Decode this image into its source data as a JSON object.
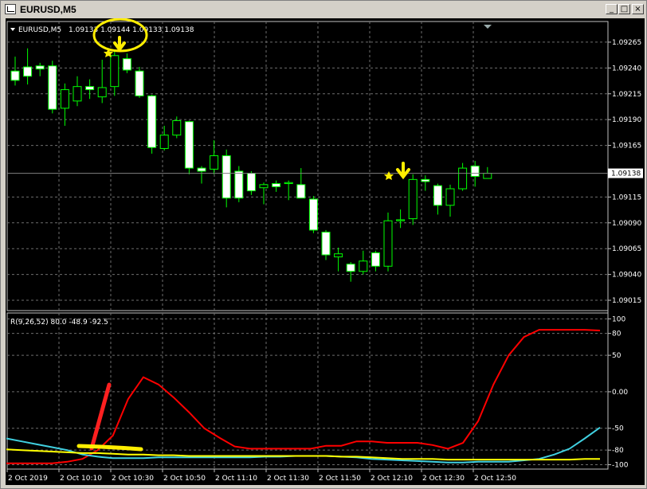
{
  "window": {
    "title": "EURUSD,M5",
    "minimize_glyph": "_",
    "restore_glyph": "□",
    "close_glyph": "×"
  },
  "header": {
    "symbol_label": "EURUSD,M5",
    "ohlc_text": "1.09133 1.09144 1.09133 1.09138",
    "current_price": "1.09138"
  },
  "indicator": {
    "label": "R(9,26,52) 80.0 -48.9 -92.5"
  },
  "colors": {
    "background": "#000000",
    "grid": "#6e6e6e",
    "axis_text": "#ffffff",
    "bull_candle": "#000000",
    "bear_candle": "#ffffff",
    "candle_wick": "#00ff00",
    "line_red": "#ff0000",
    "line_cyan": "#40d0e0",
    "line_yellow": "#ffff00",
    "annotation_yellow": "#ffee00",
    "annotation_red": "#ff2020"
  },
  "chart_data": [
    {
      "type": "candlestick",
      "title": "EURUSD,M5",
      "y_ticks": [
        "1.09265",
        "1.09240",
        "1.09215",
        "1.09190",
        "1.09165",
        "1.09115",
        "1.09090",
        "1.09065",
        "1.09040",
        "1.09015"
      ],
      "ylim": [
        1.09005,
        1.09285
      ],
      "x_ticks": [
        "2 Oct 2019",
        "2 Oct 10:10",
        "2 Oct 10:30",
        "2 Oct 10:50",
        "2 Oct 11:10",
        "2 Oct 11:30",
        "2 Oct 11:50",
        "2 Oct 12:10",
        "2 Oct 12:30",
        "2 Oct 12:50"
      ],
      "current_price": 1.09138,
      "candles": [
        {
          "o": 1.09237,
          "h": 1.09251,
          "l": 1.09223,
          "c": 1.09228
        },
        {
          "o": 1.09241,
          "h": 1.09259,
          "l": 1.09224,
          "c": 1.09232
        },
        {
          "o": 1.09242,
          "h": 1.09245,
          "l": 1.09232,
          "c": 1.09239
        },
        {
          "o": 1.09242,
          "h": 1.09247,
          "l": 1.09196,
          "c": 1.092
        },
        {
          "o": 1.09201,
          "h": 1.09225,
          "l": 1.09184,
          "c": 1.09219
        },
        {
          "o": 1.09208,
          "h": 1.09232,
          "l": 1.09203,
          "c": 1.09222
        },
        {
          "o": 1.09222,
          "h": 1.09229,
          "l": 1.0921,
          "c": 1.09219
        },
        {
          "o": 1.09212,
          "h": 1.09248,
          "l": 1.09206,
          "c": 1.09221
        },
        {
          "o": 1.09222,
          "h": 1.09256,
          "l": 1.09213,
          "c": 1.09252
        },
        {
          "o": 1.09249,
          "h": 1.09254,
          "l": 1.09235,
          "c": 1.09238
        },
        {
          "o": 1.09237,
          "h": 1.09241,
          "l": 1.09211,
          "c": 1.09213
        },
        {
          "o": 1.09213,
          "h": 1.09214,
          "l": 1.09157,
          "c": 1.09163
        },
        {
          "o": 1.09162,
          "h": 1.09184,
          "l": 1.0916,
          "c": 1.09175
        },
        {
          "o": 1.09175,
          "h": 1.09193,
          "l": 1.09172,
          "c": 1.09189
        },
        {
          "o": 1.09188,
          "h": 1.09189,
          "l": 1.09137,
          "c": 1.09143
        },
        {
          "o": 1.09143,
          "h": 1.09145,
          "l": 1.09128,
          "c": 1.0914
        },
        {
          "o": 1.09142,
          "h": 1.0917,
          "l": 1.09137,
          "c": 1.09155
        },
        {
          "o": 1.09155,
          "h": 1.09161,
          "l": 1.09105,
          "c": 1.09114
        },
        {
          "o": 1.0914,
          "h": 1.09145,
          "l": 1.0911,
          "c": 1.09114
        },
        {
          "o": 1.09138,
          "h": 1.0914,
          "l": 1.09117,
          "c": 1.09121
        },
        {
          "o": 1.09124,
          "h": 1.09129,
          "l": 1.09108,
          "c": 1.09127
        },
        {
          "o": 1.09128,
          "h": 1.09131,
          "l": 1.0912,
          "c": 1.09125
        },
        {
          "o": 1.09128,
          "h": 1.09131,
          "l": 1.09112,
          "c": 1.09129
        },
        {
          "o": 1.09127,
          "h": 1.09143,
          "l": 1.0912,
          "c": 1.09114
        },
        {
          "o": 1.09113,
          "h": 1.09116,
          "l": 1.0908,
          "c": 1.09083
        },
        {
          "o": 1.09081,
          "h": 1.09083,
          "l": 1.09054,
          "c": 1.09059
        },
        {
          "o": 1.09057,
          "h": 1.09066,
          "l": 1.09043,
          "c": 1.0906
        },
        {
          "o": 1.0905,
          "h": 1.09052,
          "l": 1.09033,
          "c": 1.09043
        },
        {
          "o": 1.09043,
          "h": 1.09063,
          "l": 1.0904,
          "c": 1.09053
        },
        {
          "o": 1.09061,
          "h": 1.09063,
          "l": 1.09043,
          "c": 1.09048
        },
        {
          "o": 1.09048,
          "h": 1.091,
          "l": 1.09043,
          "c": 1.09092
        },
        {
          "o": 1.09092,
          "h": 1.09103,
          "l": 1.09085,
          "c": 1.09093
        },
        {
          "o": 1.09094,
          "h": 1.09137,
          "l": 1.09088,
          "c": 1.09132
        },
        {
          "o": 1.09132,
          "h": 1.09136,
          "l": 1.09121,
          "c": 1.0913
        },
        {
          "o": 1.09126,
          "h": 1.09128,
          "l": 1.09098,
          "c": 1.09107
        },
        {
          "o": 1.09107,
          "h": 1.09127,
          "l": 1.09096,
          "c": 1.09123
        },
        {
          "o": 1.09123,
          "h": 1.09148,
          "l": 1.09121,
          "c": 1.09143
        },
        {
          "o": 1.09145,
          "h": 1.0915,
          "l": 1.09125,
          "c": 1.09135
        },
        {
          "o": 1.09133,
          "h": 1.09144,
          "l": 1.09133,
          "c": 1.09138
        }
      ]
    },
    {
      "type": "line",
      "title": "R(9,26,52) 80.0 -48.9 -92.5",
      "y_ticks": [
        "100",
        "80",
        "50",
        "0.00",
        "-50",
        "-80",
        "-100"
      ],
      "ylim": [
        -106,
        108
      ],
      "series": [
        {
          "color": "#ff0000",
          "values": [
            -98,
            -98,
            -98,
            -98,
            -96,
            -92,
            -80,
            -60,
            -10,
            20,
            10,
            -8,
            -28,
            -50,
            -63,
            -75,
            -78,
            -78,
            -78,
            -78,
            -78,
            -74,
            -74,
            -68,
            -68,
            -70,
            -70,
            -70,
            -73,
            -78,
            -70,
            -40,
            10,
            50,
            75,
            85,
            85,
            85,
            85,
            84
          ]
        },
        {
          "color": "#40d0e0",
          "values": [
            -64,
            -68,
            -72,
            -76,
            -80,
            -86,
            -89,
            -91,
            -91,
            -91,
            -90,
            -90,
            -90,
            -90,
            -90,
            -90,
            -90,
            -89,
            -89,
            -88,
            -88,
            -88,
            -89,
            -90,
            -92,
            -93,
            -94,
            -95,
            -96,
            -97,
            -97,
            -96,
            -96,
            -96,
            -94,
            -92,
            -86,
            -78,
            -64,
            -49
          ]
        },
        {
          "color": "#ffff00",
          "values": [
            -79,
            -80,
            -81,
            -82,
            -83,
            -84,
            -84,
            -85,
            -86,
            -86,
            -87,
            -87,
            -88,
            -88,
            -88,
            -88,
            -88,
            -88,
            -88,
            -88,
            -88,
            -88,
            -89,
            -89,
            -90,
            -91,
            -92,
            -92,
            -92,
            -93,
            -93,
            -93,
            -93,
            -93,
            -93,
            -93,
            -93,
            -93,
            -92,
            -92
          ]
        }
      ]
    }
  ]
}
